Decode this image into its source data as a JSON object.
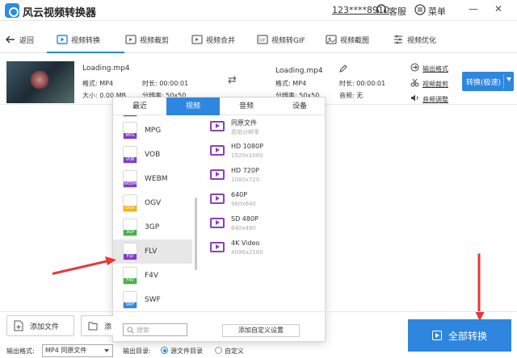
{
  "app": {
    "title": "风云视频转换器",
    "account": "123****8910",
    "service": "客服",
    "menu": "菜单"
  },
  "toolbar": {
    "back": "返回",
    "tabs": [
      {
        "label": "视频转换",
        "icon": "video-convert-icon",
        "active": true
      },
      {
        "label": "视频裁剪",
        "icon": "video-crop-icon"
      },
      {
        "label": "视频合并",
        "icon": "video-merge-icon"
      },
      {
        "label": "视频转GIF",
        "icon": "gif-icon"
      },
      {
        "label": "视频截图",
        "icon": "screenshot-icon"
      },
      {
        "label": "视频优化",
        "icon": "optimize-icon"
      }
    ]
  },
  "file": {
    "name": "Loading.mp4",
    "format": "格式: MP4",
    "duration": "时长: 00:00:01",
    "size": "大小: 0.00 MB",
    "resolution": "分辨率: 50x50",
    "out_name": "Loading.mp4",
    "out_format": "格式: MP4",
    "out_duration": "时长: 00:00:01",
    "out_resolution": "分辨率: 50x50",
    "out_audio": "音频: 无",
    "opt_output_format": "输出格式",
    "opt_video_crop": "视频裁剪",
    "opt_audio_adjust": "音频调整",
    "convert_button": "转换(极速)"
  },
  "popup": {
    "tabs": [
      "最近",
      "视频",
      "音频",
      "设备"
    ],
    "active_tab": "视频",
    "formats": [
      {
        "name": "MPG",
        "color": "#7f3fc6"
      },
      {
        "name": "VOB",
        "color": "#7f3fc6"
      },
      {
        "name": "WEBM",
        "color": "#7f3fc6"
      },
      {
        "name": "OGV",
        "color": "#f2b51d"
      },
      {
        "name": "3GP",
        "color": "#45b34a"
      },
      {
        "name": "FLV",
        "color": "#7f3fc6"
      },
      {
        "name": "F4V",
        "color": "#45b34a"
      },
      {
        "name": "SWF",
        "color": "#2e86de"
      }
    ],
    "selected_format": "FLV",
    "presets": [
      {
        "name": "同原文件",
        "sub": "原始分辨率"
      },
      {
        "name": "HD 1080P",
        "sub": "1920x1080"
      },
      {
        "name": "HD 720P",
        "sub": "1080x720"
      },
      {
        "name": "640P",
        "sub": "960x640"
      },
      {
        "name": "SD 480P",
        "sub": "640x480"
      },
      {
        "name": "4K Video",
        "sub": "4096x2160"
      }
    ],
    "search_placeholder": "搜索",
    "custom_button": "添加自定义设置"
  },
  "bottom": {
    "add_file": "添加文件",
    "add_folder": "添",
    "output_format_label": "输出格式:",
    "output_format_value": "MP4 同原文件",
    "output_dir_label": "输出目录:",
    "radio_source": "源文件目录",
    "radio_custom": "自定义",
    "convert_all": "全部转换"
  },
  "colors": {
    "accent": "#2e86de",
    "arrow": "#e53a3a",
    "preset_icon": "#8a3fbf"
  }
}
